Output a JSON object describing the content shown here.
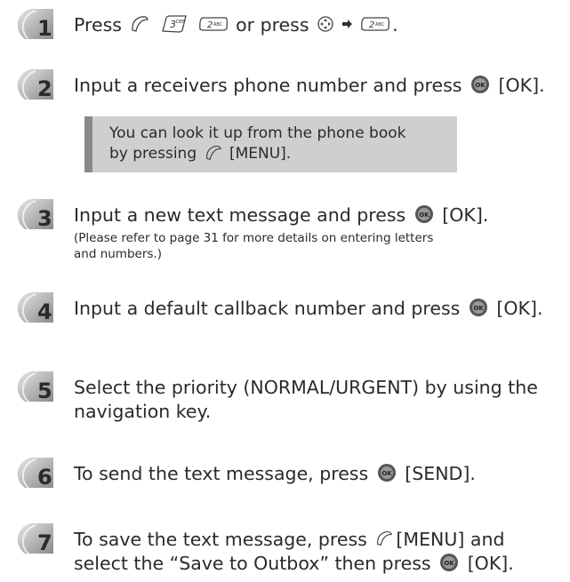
{
  "colors": {
    "text": "#2a2a2a",
    "note_bg": "#cfcfcf",
    "note_bar": "#8a8a8a",
    "badge": "#8f8f8f"
  },
  "steps": [
    {
      "number": "1",
      "parts": [
        "Press",
        "or press",
        "."
      ],
      "icons": [
        "menu-key-icon",
        "3-def-key-icon",
        "2-abc-key-icon",
        "navigation-key-icon",
        "arrow-icon",
        "2-abc-key-icon"
      ]
    },
    {
      "number": "2",
      "before": "Input a receivers phone number and press",
      "after": "[OK].",
      "icons": [
        "ok-key-icon"
      ]
    },
    {
      "number": "3",
      "before": "Input a new text message and press",
      "after": "[OK].",
      "icons": [
        "ok-key-icon"
      ]
    },
    {
      "number": "4",
      "before": "Input a default callback number and press",
      "after": "[OK].",
      "icons": [
        "ok-key-icon"
      ]
    },
    {
      "number": "5",
      "text": "Select the priority (NORMAL/URGENT) by using the navigation key."
    },
    {
      "number": "6",
      "before": "To send the text message, press",
      "after": "[SEND].",
      "icons": [
        "ok-key-icon"
      ]
    },
    {
      "number": "7",
      "before": "To save the text message, press",
      "middle": "[MENU] and select the “Save to Outbox” then press",
      "after": "[OK].",
      "icons": [
        "menu-key-icon",
        "ok-key-icon"
      ]
    }
  ],
  "note": {
    "line1": "You can look it up from the phone book",
    "line2": "by pressing",
    "line2_after": "[MENU].",
    "icon": "menu-key-icon"
  },
  "small_note": {
    "line1": "(Please refer to page 31 for more details on entering letters",
    "line2": "and numbers.)"
  }
}
